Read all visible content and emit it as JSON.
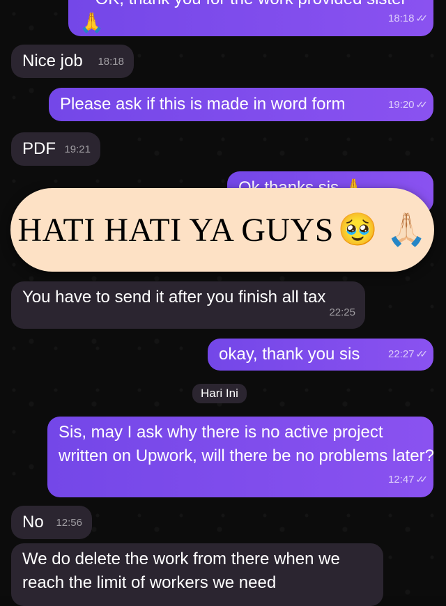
{
  "messages": {
    "m1": {
      "text": "OK, thank you for the work provided sister",
      "emoji": "🙏",
      "time": "18:18"
    },
    "m2": {
      "text": "Nice job",
      "time": "18:18"
    },
    "m3": {
      "text": "Please ask if this is made in word form",
      "time": "19:20"
    },
    "m4": {
      "text": "PDF",
      "time": "19:21"
    },
    "m5": {
      "text": "Ok thanks sis 🙏"
    },
    "m6": {
      "text": "You have to send it after you finish all tax",
      "time": "22:25"
    },
    "m7": {
      "text": "okay, thank you sis",
      "time": "22:27"
    },
    "m8": {
      "text": "Sis, may I ask why there is no active project written on Upwork, will there be no problems later?",
      "time": "12:47"
    },
    "m9": {
      "text": "No",
      "time": "12:56"
    },
    "m10": {
      "text": "We do delete the work from there when we reach the limit of workers we need"
    }
  },
  "date_separator": "Hari Ini",
  "banner": {
    "text": "HATI HATI YA GUYS",
    "emoji": "🥹 🙏🏻"
  },
  "colors": {
    "outgoing": "#7c4dec",
    "incoming": "#2b2530",
    "banner": "#fde1c5"
  }
}
